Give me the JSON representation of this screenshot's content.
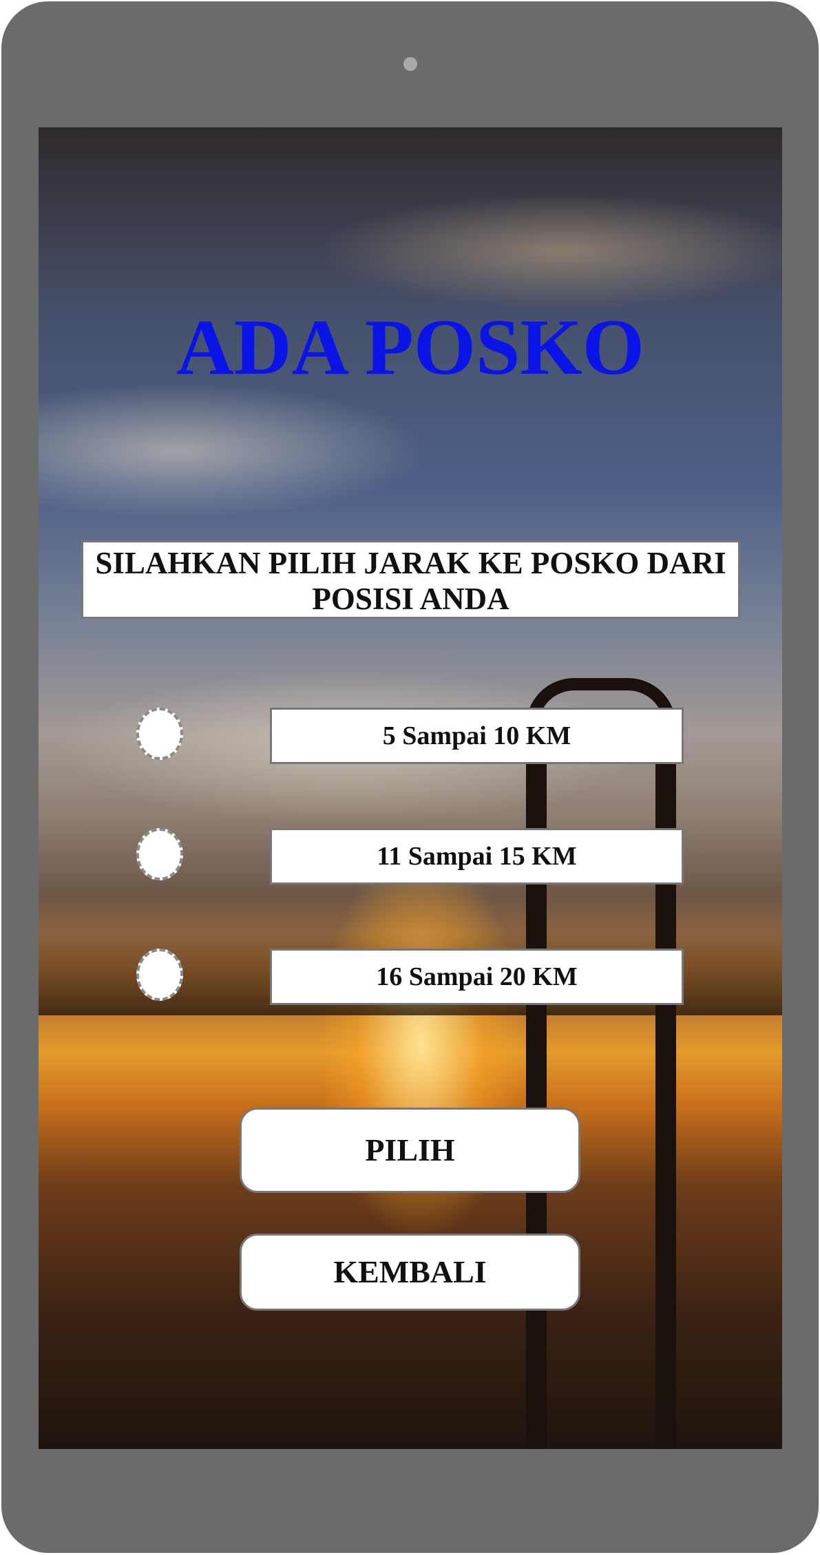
{
  "screen": {
    "title": "ADA POSKO",
    "prompt": "SILAHKAN PILIH JARAK KE POSKO DARI POSISI ANDA",
    "options": [
      {
        "label": "5 Sampai 10 KM",
        "selected": false
      },
      {
        "label": "11 Sampai 15 KM",
        "selected": false
      },
      {
        "label": "16 Sampai 20 KM",
        "selected": false
      }
    ],
    "buttons": {
      "pilih": "PILIH",
      "kembali": "KEMBALI"
    }
  },
  "colors": {
    "title": "#0a14e6",
    "device_frame": "#6b6b6b",
    "box_background": "#ffffff",
    "box_border": "#777777"
  }
}
